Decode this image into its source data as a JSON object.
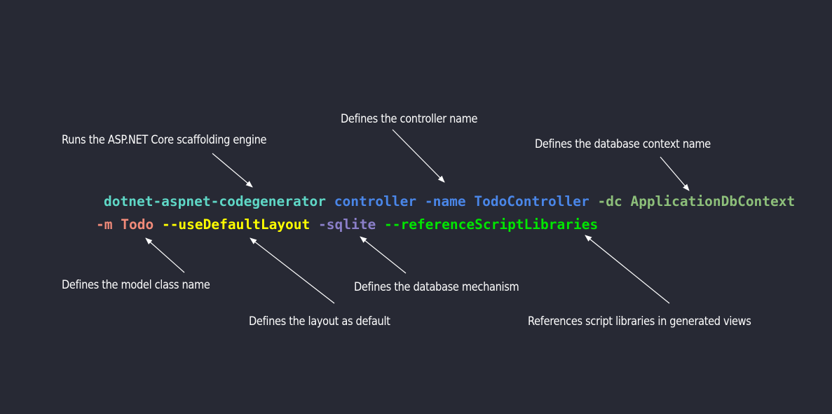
{
  "command": {
    "line1": [
      {
        "text": "dotnet-aspnet-codegenerator",
        "color": "#5fd7c6"
      },
      {
        "text": " ",
        "color": "#ffffff"
      },
      {
        "text": "controller",
        "color": "#4a86e8"
      },
      {
        "text": " ",
        "color": "#ffffff"
      },
      {
        "text": "-name",
        "color": "#4a86e8"
      },
      {
        "text": " ",
        "color": "#ffffff"
      },
      {
        "text": "TodoController",
        "color": "#4a86e8"
      },
      {
        "text": " ",
        "color": "#ffffff"
      },
      {
        "text": "-dc",
        "color": "#8dbf7a"
      },
      {
        "text": " ",
        "color": "#ffffff"
      },
      {
        "text": "ApplicationDbContext",
        "color": "#8dbf7a"
      }
    ],
    "line2": [
      {
        "text": "-m",
        "color": "#f28b7a"
      },
      {
        "text": " ",
        "color": "#ffffff"
      },
      {
        "text": "Todo",
        "color": "#f28b7a"
      },
      {
        "text": " ",
        "color": "#ffffff"
      },
      {
        "text": "--useDefaultLayout",
        "color": "#ffff00"
      },
      {
        "text": " ",
        "color": "#ffffff"
      },
      {
        "text": "-sqlite",
        "color": "#8b7fc9"
      },
      {
        "text": " ",
        "color": "#ffffff"
      },
      {
        "text": "--referenceScriptLibraries",
        "color": "#00e600"
      }
    ]
  },
  "annotations": {
    "scaffolding_engine": "Runs the ASP.NET Core scaffolding engine",
    "controller_name": "Defines the controller name",
    "db_context_name": "Defines the database context name",
    "model_class_name": "Defines the model class name",
    "layout_default": "Defines the layout as default",
    "database_mechanism": "Defines the database mechanism",
    "script_libraries": "References script libraries in generated views"
  },
  "colors": {
    "background": "#272934",
    "annotation_text": "#ffffff",
    "arrow": "#ffffff"
  }
}
